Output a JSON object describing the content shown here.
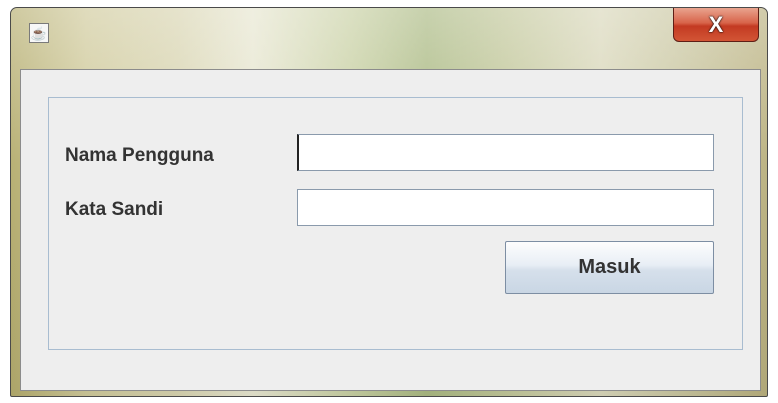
{
  "window": {
    "icon": "java-coffee-icon",
    "close_label": "X"
  },
  "form": {
    "username_label": "Nama Pengguna",
    "username_value": "",
    "password_label": "Kata Sandi",
    "password_value": "",
    "submit_label": "Masuk"
  },
  "colors": {
    "client_bg": "#eeeeee",
    "panel_border": "#a8bcd0",
    "close_button": "#c33a22",
    "label_text": "#333333"
  }
}
